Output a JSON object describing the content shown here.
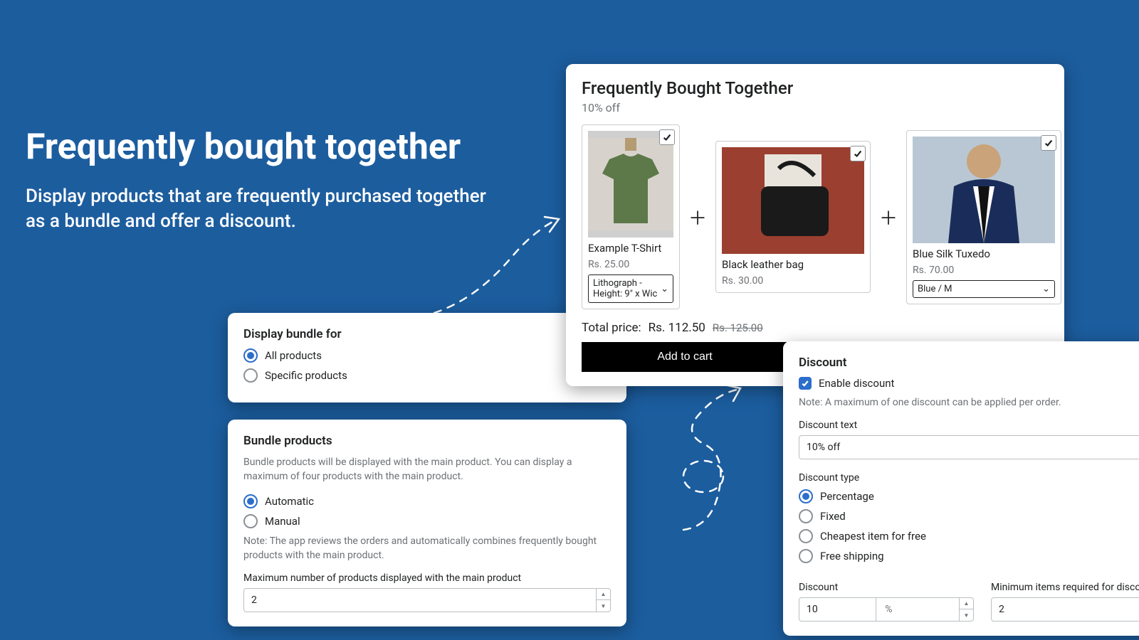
{
  "hero": {
    "title": "Frequently bought together",
    "subtitle": "Display products that are frequently purchased together as a bundle and offer a discount."
  },
  "display_card": {
    "heading": "Display bundle for",
    "options": {
      "all": "All products",
      "specific": "Specific products"
    }
  },
  "bundle_card": {
    "heading": "Bundle products",
    "description": "Bundle products will be displayed with the main product. You can display a maximum of four products with the main product.",
    "options": {
      "auto": "Automatic",
      "manual": "Manual"
    },
    "note": "Note: The app reviews the orders and automatically combines frequently bought products with the main product.",
    "max_label": "Maximum number of products displayed with the main product",
    "max_value": "2"
  },
  "fbt": {
    "heading": "Frequently Bought Together",
    "sub": "10% off",
    "products": [
      {
        "name": "Example T-Shirt",
        "price": "Rs. 25.00",
        "variant": "Lithograph - Height: 9\" x Wic"
      },
      {
        "name": "Black leather bag",
        "price": "Rs. 30.00",
        "variant": ""
      },
      {
        "name": "Blue Silk Tuxedo",
        "price": "Rs. 70.00",
        "variant": "Blue / M"
      }
    ],
    "total_label": "Total price:",
    "total_price": "Rs. 112.50",
    "compare_price": "Rs. 125.00",
    "add_to_cart": "Add to cart"
  },
  "discount": {
    "heading": "Discount",
    "enable_label": "Enable discount",
    "note": "Note: A maximum of one discount can be applied per order.",
    "text_label": "Discount text",
    "text_value": "10% off",
    "type_label": "Discount type",
    "types": {
      "percentage": "Percentage",
      "fixed": "Fixed",
      "cheapest": "Cheapest item for free",
      "free_shipping": "Free shipping"
    },
    "amount_label": "Discount",
    "amount_value": "10",
    "amount_unit": "%",
    "min_label": "Minimum items required for discount",
    "min_value": "2"
  }
}
